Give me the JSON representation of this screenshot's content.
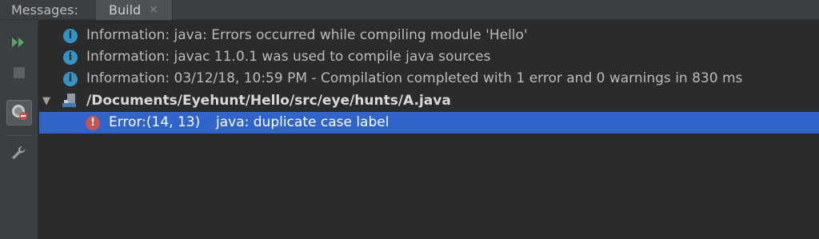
{
  "tabs": {
    "title": "Messages:",
    "active_tab_label": "Build",
    "close_glyph": "×"
  },
  "toolbar": {
    "buttons": [
      {
        "icon": "rerun-icon"
      },
      {
        "icon": "stop-icon"
      },
      {
        "icon": "show-errors-icon"
      },
      {
        "icon": "settings-wrench-icon"
      }
    ]
  },
  "messages": [
    {
      "type": "info",
      "icon": "info-icon",
      "text": "Information: java: Errors occurred while compiling module 'Hello'"
    },
    {
      "type": "info",
      "icon": "info-icon",
      "text": "Information: javac 11.0.1 was used to compile java sources"
    },
    {
      "type": "info",
      "icon": "info-icon",
      "text": "Information: 03/12/18, 10:59 PM - Compilation completed with 1 error and 0 warnings in 830 ms"
    }
  ],
  "file_node": {
    "expand_glyph": "▼",
    "icon": "java-file-icon",
    "path": "/Documents/Eyehunt/Hello/src/eye/hunts/A.java"
  },
  "error": {
    "icon": "error-icon",
    "location": "Error:(14, 13)",
    "message": "java: duplicate case label"
  },
  "colors": {
    "background": "#2b2b2b",
    "panel": "#3c3f41",
    "selection": "#2f65ca",
    "info": "#3592c4",
    "error": "#c75450",
    "run_green": "#59a869"
  }
}
